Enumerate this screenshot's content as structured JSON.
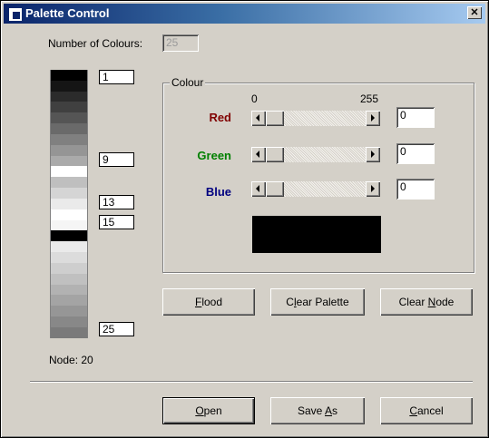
{
  "window": {
    "title": "Palette Control",
    "close_label": "✕"
  },
  "num_colours": {
    "label": "Number of Colours:",
    "value": "25"
  },
  "palette": {
    "swatch_colors": [
      "#000000",
      "#151515",
      "#2b2b2b",
      "#404040",
      "#555555",
      "#6a6a6a",
      "#808080",
      "#959595",
      "#aaaaaa",
      "#ffffff",
      "#bfbfbf",
      "#d5d5d5",
      "#eaeaea",
      "#ffffff",
      "#f5f5f5",
      "#000000",
      "#eaeaea",
      "#dcdcdc",
      "#cecece",
      "#c0c0c0",
      "#b2b2b2",
      "#a4a4a4",
      "#969696",
      "#888888",
      "#7a7a7a"
    ],
    "markers": [
      {
        "label": "1"
      },
      {
        "label": "9"
      },
      {
        "label": "13"
      },
      {
        "label": "15"
      },
      {
        "label": "25"
      }
    ]
  },
  "node_label": "Node: 20",
  "colour_group": {
    "label": "Colour",
    "scale_min": "0",
    "scale_max": "255",
    "channels": [
      {
        "label": "Red",
        "color": "#800000",
        "value": "0"
      },
      {
        "label": "Green",
        "color": "#008000",
        "value": "0"
      },
      {
        "label": "Blue",
        "color": "#000080",
        "value": "0"
      }
    ],
    "preview_color": "#000000"
  },
  "buttons": {
    "flood": {
      "pre": "",
      "accel": "F",
      "post": "lood"
    },
    "clear_palette": {
      "pre": "C",
      "accel": "l",
      "post": "ear Palette"
    },
    "clear_node": {
      "pre": "Clear ",
      "accel": "N",
      "post": "ode"
    },
    "open": {
      "pre": "",
      "accel": "O",
      "post": "pen"
    },
    "save_as": {
      "pre": "Save ",
      "accel": "A",
      "post": "s"
    },
    "cancel": {
      "pre": "",
      "accel": "C",
      "post": "ancel"
    }
  }
}
